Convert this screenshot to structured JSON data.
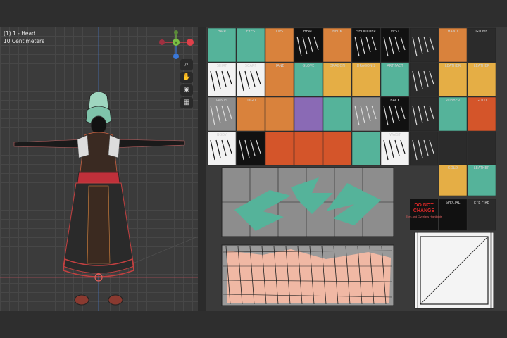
{
  "viewport": {
    "object_info": "(1) 1 - Head",
    "unit_info": "10 Centimeters",
    "gizmo": {
      "x_color": "#e0404a",
      "y_color": "#7ac143",
      "z_color": "#3a78d8",
      "y_label": "Y"
    },
    "tools": [
      {
        "name": "zoom-icon",
        "glyph": "⌕"
      },
      {
        "name": "pan-hand-icon",
        "glyph": "✋"
      },
      {
        "name": "camera-icon",
        "glyph": "◉"
      },
      {
        "name": "grid-icon",
        "glyph": "▦"
      }
    ]
  },
  "uv_editor": {
    "rows": [
      [
        "HAIR",
        "EYES",
        "LIPS",
        "HEAD",
        "NECK",
        "SHOULDER",
        "VEST",
        "",
        "HAND",
        "GLOVE"
      ],
      [
        "SHIRT",
        "SCARF",
        "HAND",
        "GLOVE",
        "DRAGON",
        "DRAGON 2",
        "ARTIFACT",
        "",
        "LEATHER",
        "LEATHER"
      ],
      [
        "PANTS",
        "LOGO",
        "",
        "",
        "",
        "",
        "BACK",
        "",
        "RUBBER",
        "GOLD"
      ],
      [
        "BODY",
        "",
        "",
        "",
        "",
        "",
        "WAIST",
        "",
        "",
        ""
      ],
      [
        "",
        "",
        "",
        "",
        "",
        "",
        "",
        "",
        "GOLD",
        "LEATHER"
      ],
      [
        "",
        "",
        "",
        "",
        "",
        "",
        "",
        "",
        "SPECIAL",
        "EYE FIRE"
      ]
    ],
    "warning": {
      "title_line1": "DO NOT",
      "title_line2": "CHANGE",
      "sub": "Tiles and Overlays Highlights"
    },
    "colors": {
      "teal": "#55b39a",
      "orange": "#d9823c",
      "yellow": "#e5ae45",
      "red_orange": "#d4552a",
      "dark": "#2b2b2b",
      "gray": "#8c8c8c",
      "black": "#111111",
      "white": "#f2f2f2",
      "purple": "#8a6ab5",
      "peach": "#f0b8a4",
      "brown": "#b97a40"
    }
  }
}
